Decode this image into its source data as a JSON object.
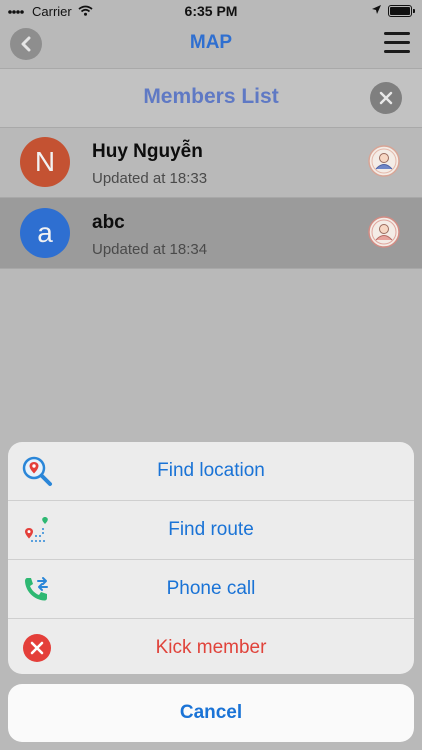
{
  "status_bar": {
    "carrier": "Carrier",
    "time": "6:35 PM",
    "icons": [
      "signal-dots",
      "wifi-icon",
      "location-arrow-icon",
      "battery-icon"
    ]
  },
  "nav": {
    "title": "MAP",
    "back_icon": "chevron-left-icon",
    "menu_icon": "hamburger-menu-icon"
  },
  "members_panel": {
    "title": "Members List",
    "close_icon": "close-icon",
    "members": [
      {
        "initial": "N",
        "name": "Huy Nguyễn",
        "updated": "Updated at 18:33",
        "avatar_color": "#c45232",
        "selected": false
      },
      {
        "initial": "a",
        "name": "abc",
        "updated": "Updated at 18:34",
        "avatar_color": "#2e6fd1",
        "selected": true
      }
    ]
  },
  "action_sheet": {
    "actions": [
      {
        "label": "Find location",
        "icon": "search-location-icon",
        "style": "default"
      },
      {
        "label": "Find route",
        "icon": "route-icon",
        "style": "default"
      },
      {
        "label": "Phone call",
        "icon": "phone-call-icon",
        "style": "default"
      },
      {
        "label": "Kick member",
        "icon": "kick-icon",
        "style": "destructive"
      }
    ],
    "cancel_label": "Cancel"
  },
  "colors": {
    "accent": "#1a73d6",
    "title_blue": "#2f6fd0",
    "members_title": "#5f79c4",
    "destructive": "#e0433b"
  }
}
